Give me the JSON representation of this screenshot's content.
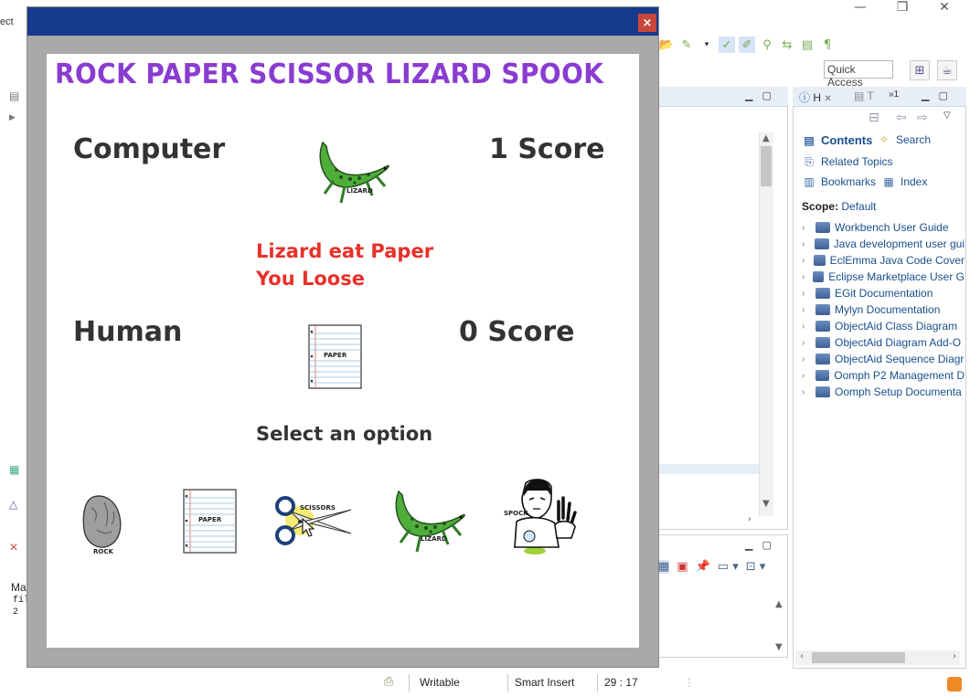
{
  "background_app": {
    "left_fragment": "ect",
    "quick_access_placeholder": "Quick Access",
    "status": {
      "mode": "Writable",
      "insert": "Smart Insert",
      "position": "29 : 17"
    },
    "left_panel_fragment": "Ma",
    "console_lines": [
      "fil",
      "2"
    ],
    "help": {
      "tab_label": "H",
      "tab2_label": "T",
      "tab_count": "1",
      "links": [
        {
          "label": "Contents",
          "icon": "contents-icon"
        },
        {
          "label": "Search",
          "icon": "search-icon"
        },
        {
          "label": "Related Topics",
          "icon": "related-topics-icon"
        },
        {
          "label": "Bookmarks",
          "icon": "bookmarks-icon"
        },
        {
          "label": "Index",
          "icon": "index-icon"
        }
      ],
      "scope_label": "Scope:",
      "scope_value": "Default",
      "books": [
        "Workbench User Guide",
        "Java development user gui",
        "EclEmma Java Code Cover",
        "Eclipse Marketplace User G",
        "EGit Documentation",
        "Mylyn Documentation",
        "ObjectAid Class Diagram",
        "ObjectAid Diagram Add-O",
        "ObjectAid Sequence Diagr",
        "Oomph P2 Management D",
        "Oomph Setup Documenta"
      ]
    }
  },
  "game": {
    "close_label": "×",
    "title": "ROCK PAPER SCISSOR LIZARD SPOOK",
    "computer_label": "Computer",
    "computer_score": "1 Score",
    "computer_choice": "LIZARD",
    "human_label": "Human",
    "human_score": "0 Score",
    "human_choice": "PAPER",
    "result_line1": "Lizard eat Paper",
    "result_line2": "You Loose",
    "select_prompt": "Select an option",
    "options": [
      {
        "label": "ROCK"
      },
      {
        "label": "PAPER"
      },
      {
        "label": "SCISSORS"
      },
      {
        "label": "LIZARD"
      },
      {
        "label": "SPOCK"
      }
    ]
  },
  "colors": {
    "title_purple": "#8a3cd1",
    "result_red": "#e8302a",
    "titlebar_blue": "#163a8c",
    "frame_gray": "#a9a9a9"
  }
}
